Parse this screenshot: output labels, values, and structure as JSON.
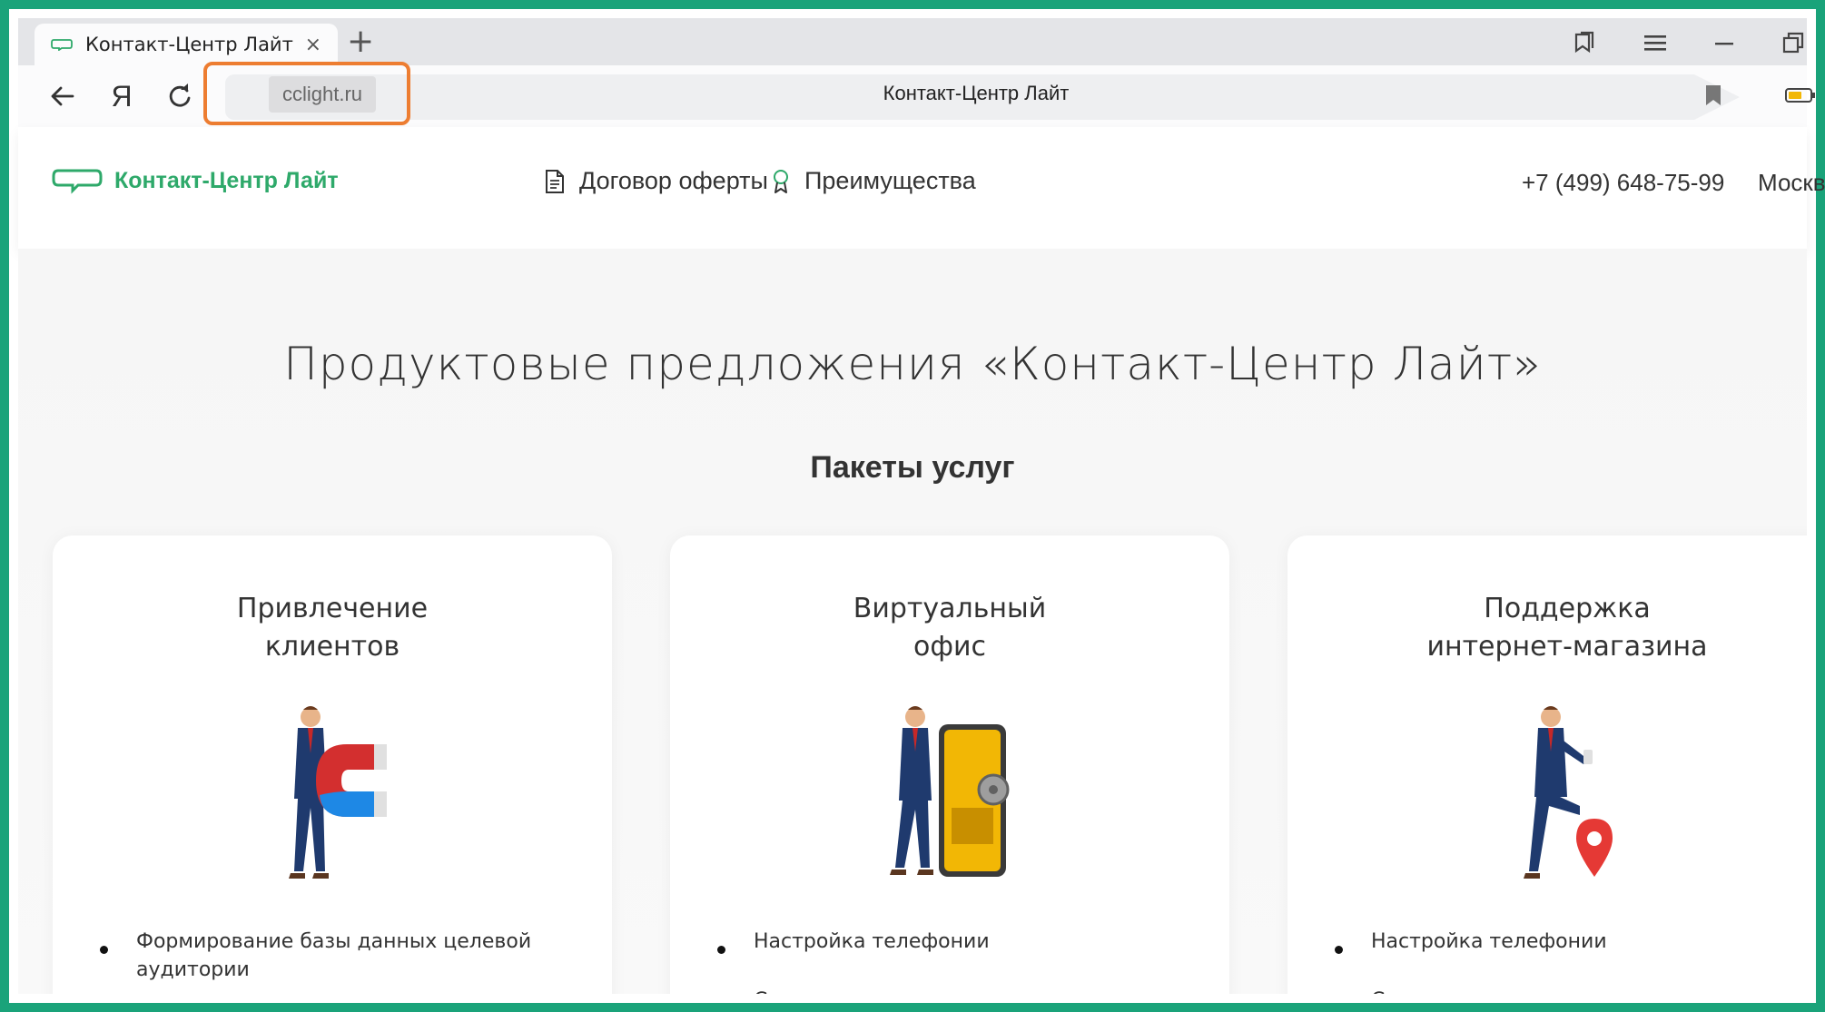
{
  "browser": {
    "tab_title": "Контакт-Центр Лайт",
    "tab_close": "×",
    "new_tab": "+",
    "yandex_button": "Я",
    "domain": "cclight.ru",
    "page_title": "Контакт-Центр Лайт"
  },
  "site": {
    "logo_text": "Контакт-Центр Лайт",
    "nav": [
      {
        "label": "Договор оферты",
        "icon": "document-icon"
      },
      {
        "label": "Преимущества",
        "icon": "award-icon"
      }
    ],
    "phone": "+7 (499) 648-75-99",
    "city": "Москв"
  },
  "content": {
    "heading": "Продуктовые предложения «Контакт-Центр Лайт»",
    "subheading": "Пакеты услуг",
    "cards": [
      {
        "title_line1": "Привлечение",
        "title_line2": "клиентов",
        "illustration": "businessman-with-magnet",
        "items": [
          "Формирование базы данных целевой аудитории"
        ]
      },
      {
        "title_line1": "Виртуальный",
        "title_line2": "офис",
        "illustration": "businessman-with-safe",
        "items": [
          "Настройка телефонии",
          "Составление и программирование"
        ]
      },
      {
        "title_line1": "Поддержка",
        "title_line2": "интернет-магазина",
        "illustration": "businessman-with-map-pin",
        "items": [
          "Настройка телефонии",
          "Составление и программирование"
        ]
      }
    ]
  },
  "colors": {
    "frame": "#1aa37a",
    "brand_green": "#2ea96a",
    "highlight": "#ed7d31"
  }
}
